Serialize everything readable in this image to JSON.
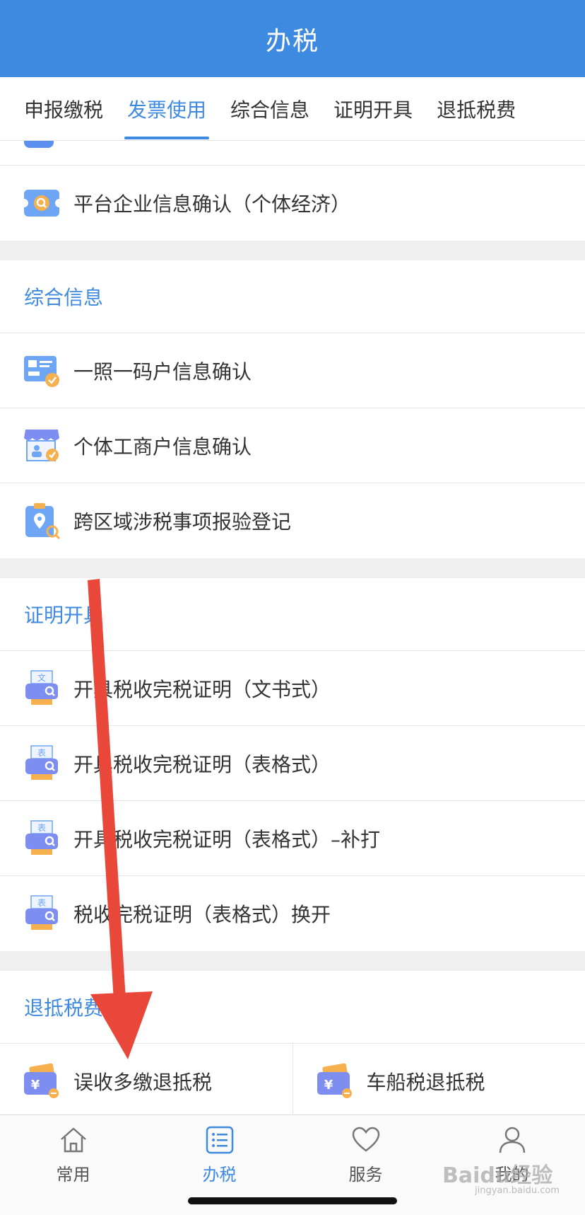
{
  "header": {
    "title": "办税"
  },
  "tabs": [
    {
      "label": "申报缴税",
      "active": false
    },
    {
      "label": "发票使用",
      "active": true
    },
    {
      "label": "综合信息",
      "active": false
    },
    {
      "label": "证明开具",
      "active": false
    },
    {
      "label": "退抵税费",
      "active": false
    }
  ],
  "first_group": {
    "items": [
      {
        "label": "平台企业信息确认（个体经济）",
        "icon": "ticket-search-icon"
      }
    ]
  },
  "groups": [
    {
      "title": "综合信息",
      "items": [
        {
          "label": "一照一码户信息确认",
          "icon": "license-check-icon"
        },
        {
          "label": "个体工商户信息确认",
          "icon": "shop-check-icon"
        },
        {
          "label": "跨区域涉税事项报验登记",
          "icon": "location-search-icon"
        }
      ]
    },
    {
      "title": "证明开具",
      "items": [
        {
          "label": "开具税收完税证明（文书式）",
          "icon": "printer-doc-icon",
          "tag": "文"
        },
        {
          "label": "开具税收完税证明（表格式）",
          "icon": "printer-table-icon",
          "tag": "表"
        },
        {
          "label": "开具税收完税证明（表格式）–补打",
          "icon": "printer-table-icon",
          "tag": "表"
        },
        {
          "label": "税收完税证明（表格式）换开",
          "icon": "printer-table-icon",
          "tag": "表"
        }
      ]
    },
    {
      "title": "退抵税费",
      "items": [
        {
          "label": "误收多缴退抵税",
          "icon": "refund-card-icon"
        },
        {
          "label": "车船税退抵税",
          "icon": "refund-card-icon"
        }
      ]
    }
  ],
  "tabbar": [
    {
      "label": "常用",
      "icon": "home-icon",
      "active": false
    },
    {
      "label": "办税",
      "icon": "list-icon",
      "active": true
    },
    {
      "label": "服务",
      "icon": "heart-icon",
      "active": false
    },
    {
      "label": "我的",
      "icon": "user-icon",
      "active": false
    }
  ],
  "watermark": {
    "text": "Baidu经验",
    "sub": "jingyan.baidu.com"
  },
  "colors": {
    "brand": "#3f8ae1",
    "annotation_arrow": "#e8473a"
  }
}
